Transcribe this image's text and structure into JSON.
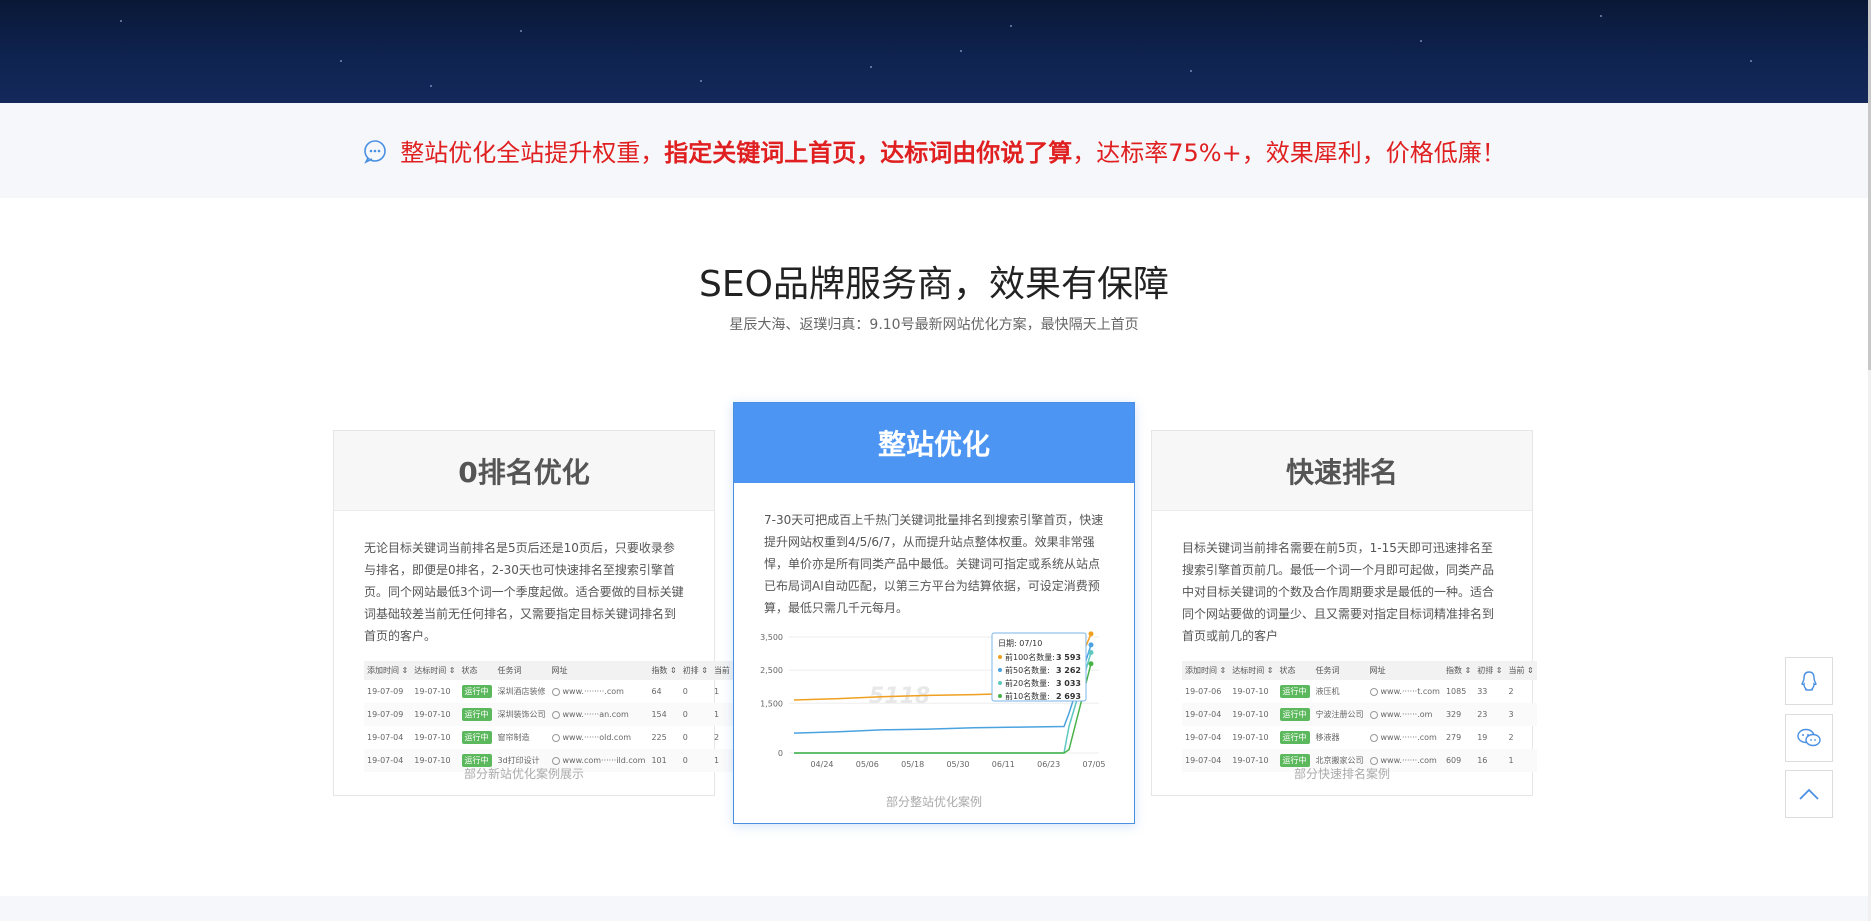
{
  "banner": {
    "part1": "整站优化全站提升权重，",
    "part2": "指定关键词上首页，达标词由你说了算",
    "part3": "，达标率75%+，效果犀利，价格低廉！",
    "icon": "chat-bubble-icon",
    "color": "#e02020"
  },
  "section": {
    "title": "SEO品牌服务商，效果有保障",
    "subtitle": "星辰大海、返璞归真：9.10号最新网站优化方案，最快隔天上首页"
  },
  "cards": {
    "left": {
      "title": "0排名优化",
      "desc": "无论目标关键词当前排名是5页后还是10页后，只要收录参与排名，即便是0排名，2-30天也可快速排名至搜索引擎首页。同个网站最低3个词一个季度起做。适合要做的目标关键词基础较差当前无任何排名，又需要指定目标关键词排名到首页的客户。",
      "caption": "部分新站优化案例展示",
      "table": {
        "headers": [
          "添加时间 ⇕",
          "达标时间 ⇕",
          "状态",
          "任务词",
          "网址",
          "指数 ⇕",
          "初排 ⇕",
          "当前 ⇕"
        ],
        "rows": [
          [
            "19-07-09",
            "19-07-10",
            "运行中",
            "深圳酒店装修",
            "www.········.com",
            "64",
            "0",
            "1"
          ],
          [
            "19-07-09",
            "19-07-10",
            "运行中",
            "深圳装饰公司",
            "www.······an.com",
            "154",
            "0",
            "1"
          ],
          [
            "19-07-04",
            "19-07-10",
            "运行中",
            "窗帘制造",
            "www.······old.com",
            "225",
            "0",
            "2"
          ],
          [
            "19-07-04",
            "19-07-10",
            "运行中",
            "3d打印设计",
            "www.com······ild.com",
            "101",
            "0",
            "1"
          ]
        ]
      }
    },
    "middle": {
      "title": "整站优化",
      "desc": "7-30天可把成百上千热门关键词批量排名到搜索引擎首页，快速提升网站权重到4/5/6/7，从而提升站点整体权重。效果非常强悍，单价亦是所有同类产品中最低。关键词可指定或系统从站点已布局词AI自动匹配，以第三方平台为结算依据，可设定消费预算，最低只需几千元每月。",
      "caption": "部分整站优化案例"
    },
    "right": {
      "title": "快速排名",
      "desc": "目标关键词当前排名需要在前5页，1-15天即可迅速排名至搜索引擎首页前几。最低一个词一个月即可起做，同类产品中对目标关键词的个数及合作周期要求是最低的一种。适合同个网站要做的词量少、且又需要对指定目标词精准排名到首页或前几的客户",
      "caption": "部分快速排名案例",
      "table": {
        "headers": [
          "添加时间 ⇕",
          "达标时间 ⇕",
          "状态",
          "任务词",
          "网址",
          "指数 ⇕",
          "初排 ⇕",
          "当前 ⇕"
        ],
        "rows": [
          [
            "19-07-06",
            "19-07-10",
            "运行中",
            "液压机",
            "www.······t.com",
            "1085",
            "33",
            "2"
          ],
          [
            "19-07-04",
            "19-07-10",
            "运行中",
            "宁波注册公司",
            "www.······.om",
            "329",
            "23",
            "3"
          ],
          [
            "19-07-04",
            "19-07-10",
            "运行中",
            "移液器",
            "www.······.com",
            "279",
            "19",
            "2"
          ],
          [
            "19-07-04",
            "19-07-10",
            "运行中",
            "北京搬家公司",
            "www.······.com",
            "609",
            "16",
            "1"
          ]
        ]
      }
    }
  },
  "chart_data": {
    "type": "line",
    "x_ticks": [
      "04/24",
      "05/06",
      "05/18",
      "05/30",
      "06/11",
      "06/23",
      "07/05"
    ],
    "y_ticks": [
      "3,500",
      "2,500",
      "1,500",
      "0"
    ],
    "ylim": [
      0,
      3500
    ],
    "watermark": "5118",
    "series": [
      {
        "name": "前100名数量",
        "color": "#f0a020",
        "values": [
          1600,
          1640,
          1700,
          1740,
          1760,
          1800,
          1860,
          2000,
          3593
        ]
      },
      {
        "name": "前50名数量",
        "color": "#4aa3df",
        "values": [
          600,
          640,
          700,
          720,
          760,
          780,
          800,
          1200,
          3262
        ]
      },
      {
        "name": "前20名数量",
        "color": "#5dc9c0",
        "values": [
          0,
          0,
          0,
          0,
          0,
          0,
          0,
          800,
          3033
        ]
      },
      {
        "name": "前10名数量",
        "color": "#49b34a",
        "values": [
          0,
          0,
          0,
          0,
          0,
          0,
          0,
          100,
          2693
        ]
      }
    ],
    "tooltip": {
      "date": "日期: 07/10",
      "items": [
        {
          "label": "前100名数量",
          "value": "3 593",
          "color": "#f0a020"
        },
        {
          "label": "前50名数量",
          "value": "3 262",
          "color": "#4aa3df"
        },
        {
          "label": "前20名数量",
          "value": "3 033",
          "color": "#5dc9c0"
        },
        {
          "label": "前10名数量",
          "value": "2 693",
          "color": "#49b34a"
        }
      ]
    }
  },
  "float_buttons": {
    "qq": "qq-penguin-icon",
    "wechat": "wechat-icon",
    "top": "chevron-up-icon"
  }
}
